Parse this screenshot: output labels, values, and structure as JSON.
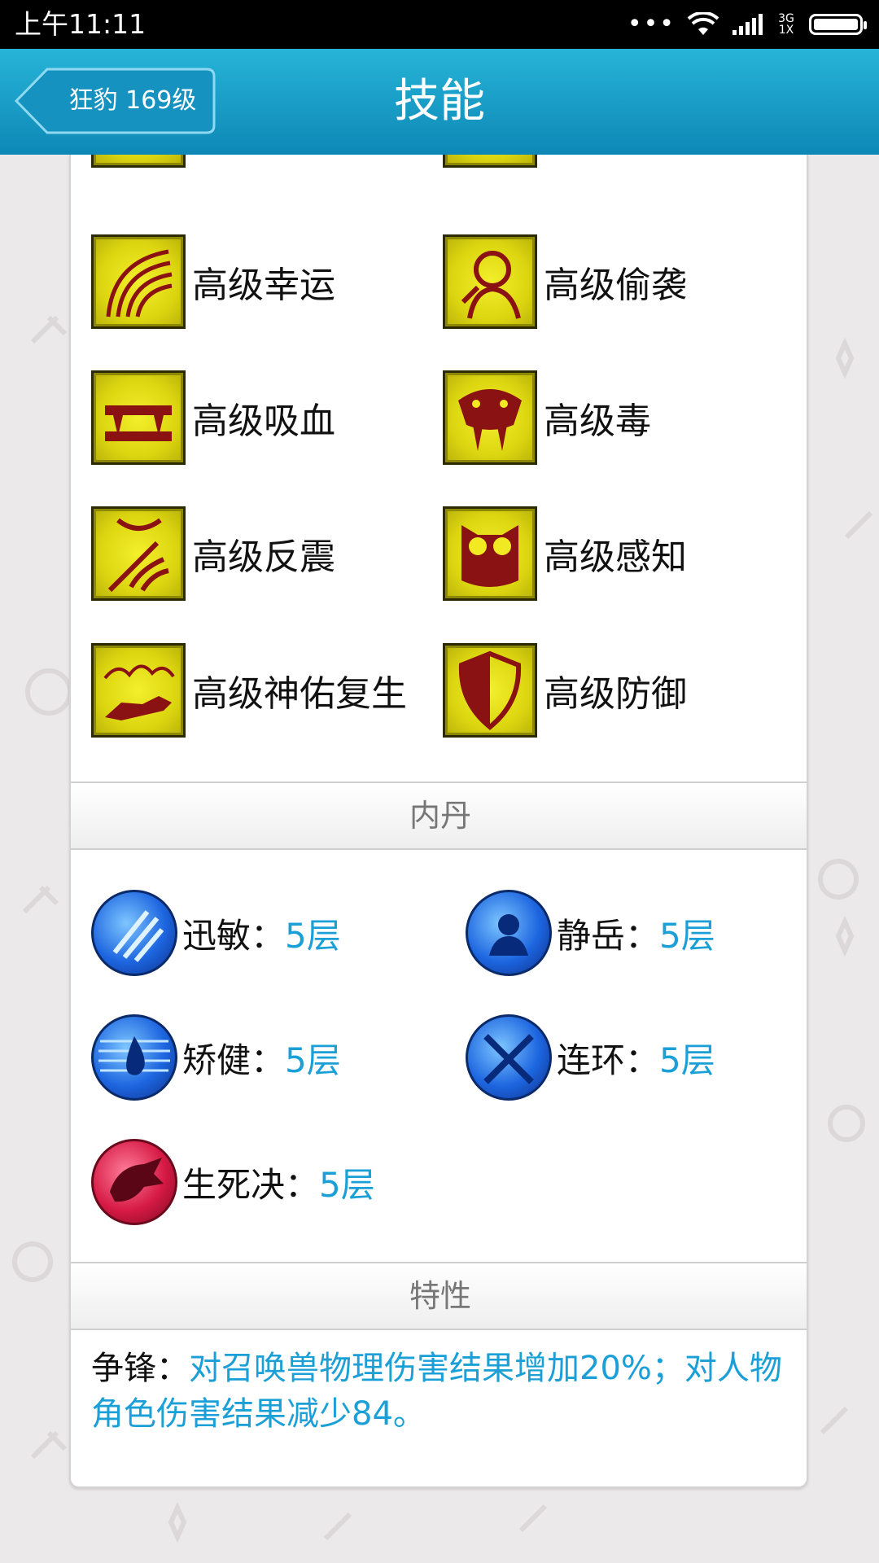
{
  "status_bar": {
    "time": "上午11:11",
    "overflow": "•••",
    "network_top": "3G",
    "network_bottom": "1X"
  },
  "header": {
    "back_label": "狂豹 169级",
    "title": "技能"
  },
  "skills": [
    {
      "label": "高级幸运",
      "icon": "rainbow-arcs-icon"
    },
    {
      "label": "高级偷袭",
      "icon": "hooded-figure-icon"
    },
    {
      "label": "高级吸血",
      "icon": "fangs-icon"
    },
    {
      "label": "高级毒",
      "icon": "snake-head-icon"
    },
    {
      "label": "高级反震",
      "icon": "shock-wave-icon"
    },
    {
      "label": "高级感知",
      "icon": "owl-icon"
    },
    {
      "label": "高级神佑复生",
      "icon": "spirit-wolf-icon"
    },
    {
      "label": "高级防御",
      "icon": "shield-icon"
    }
  ],
  "neidan": {
    "title": "内丹",
    "items": [
      {
        "name": "迅敏",
        "sep": "：",
        "value": "5层",
        "color": "blue",
        "icon": "claw-slash-icon"
      },
      {
        "name": "静岳",
        "sep": "：",
        "value": "5层",
        "color": "blue",
        "icon": "meditating-figure-icon"
      },
      {
        "name": "矫健",
        "sep": "：",
        "value": "5层",
        "color": "blue",
        "icon": "water-drop-icon"
      },
      {
        "name": "连环",
        "sep": "：",
        "value": "5层",
        "color": "blue",
        "icon": "crossed-swords-icon"
      },
      {
        "name": "生死决",
        "sep": "：",
        "value": "5层",
        "color": "red",
        "icon": "dragon-head-icon"
      }
    ]
  },
  "traits": {
    "title": "特性",
    "name": "争锋",
    "sep": "：",
    "description": "对召唤兽物理伤害结果增加20%；对人物角色伤害结果减少84。"
  },
  "colors": {
    "header_top": "#27b4d8",
    "header_bottom": "#0d88b6",
    "value_blue": "#1a9fd6",
    "skill_icon_yellow": "#e6df14",
    "skill_icon_glyph": "#8a1212"
  }
}
